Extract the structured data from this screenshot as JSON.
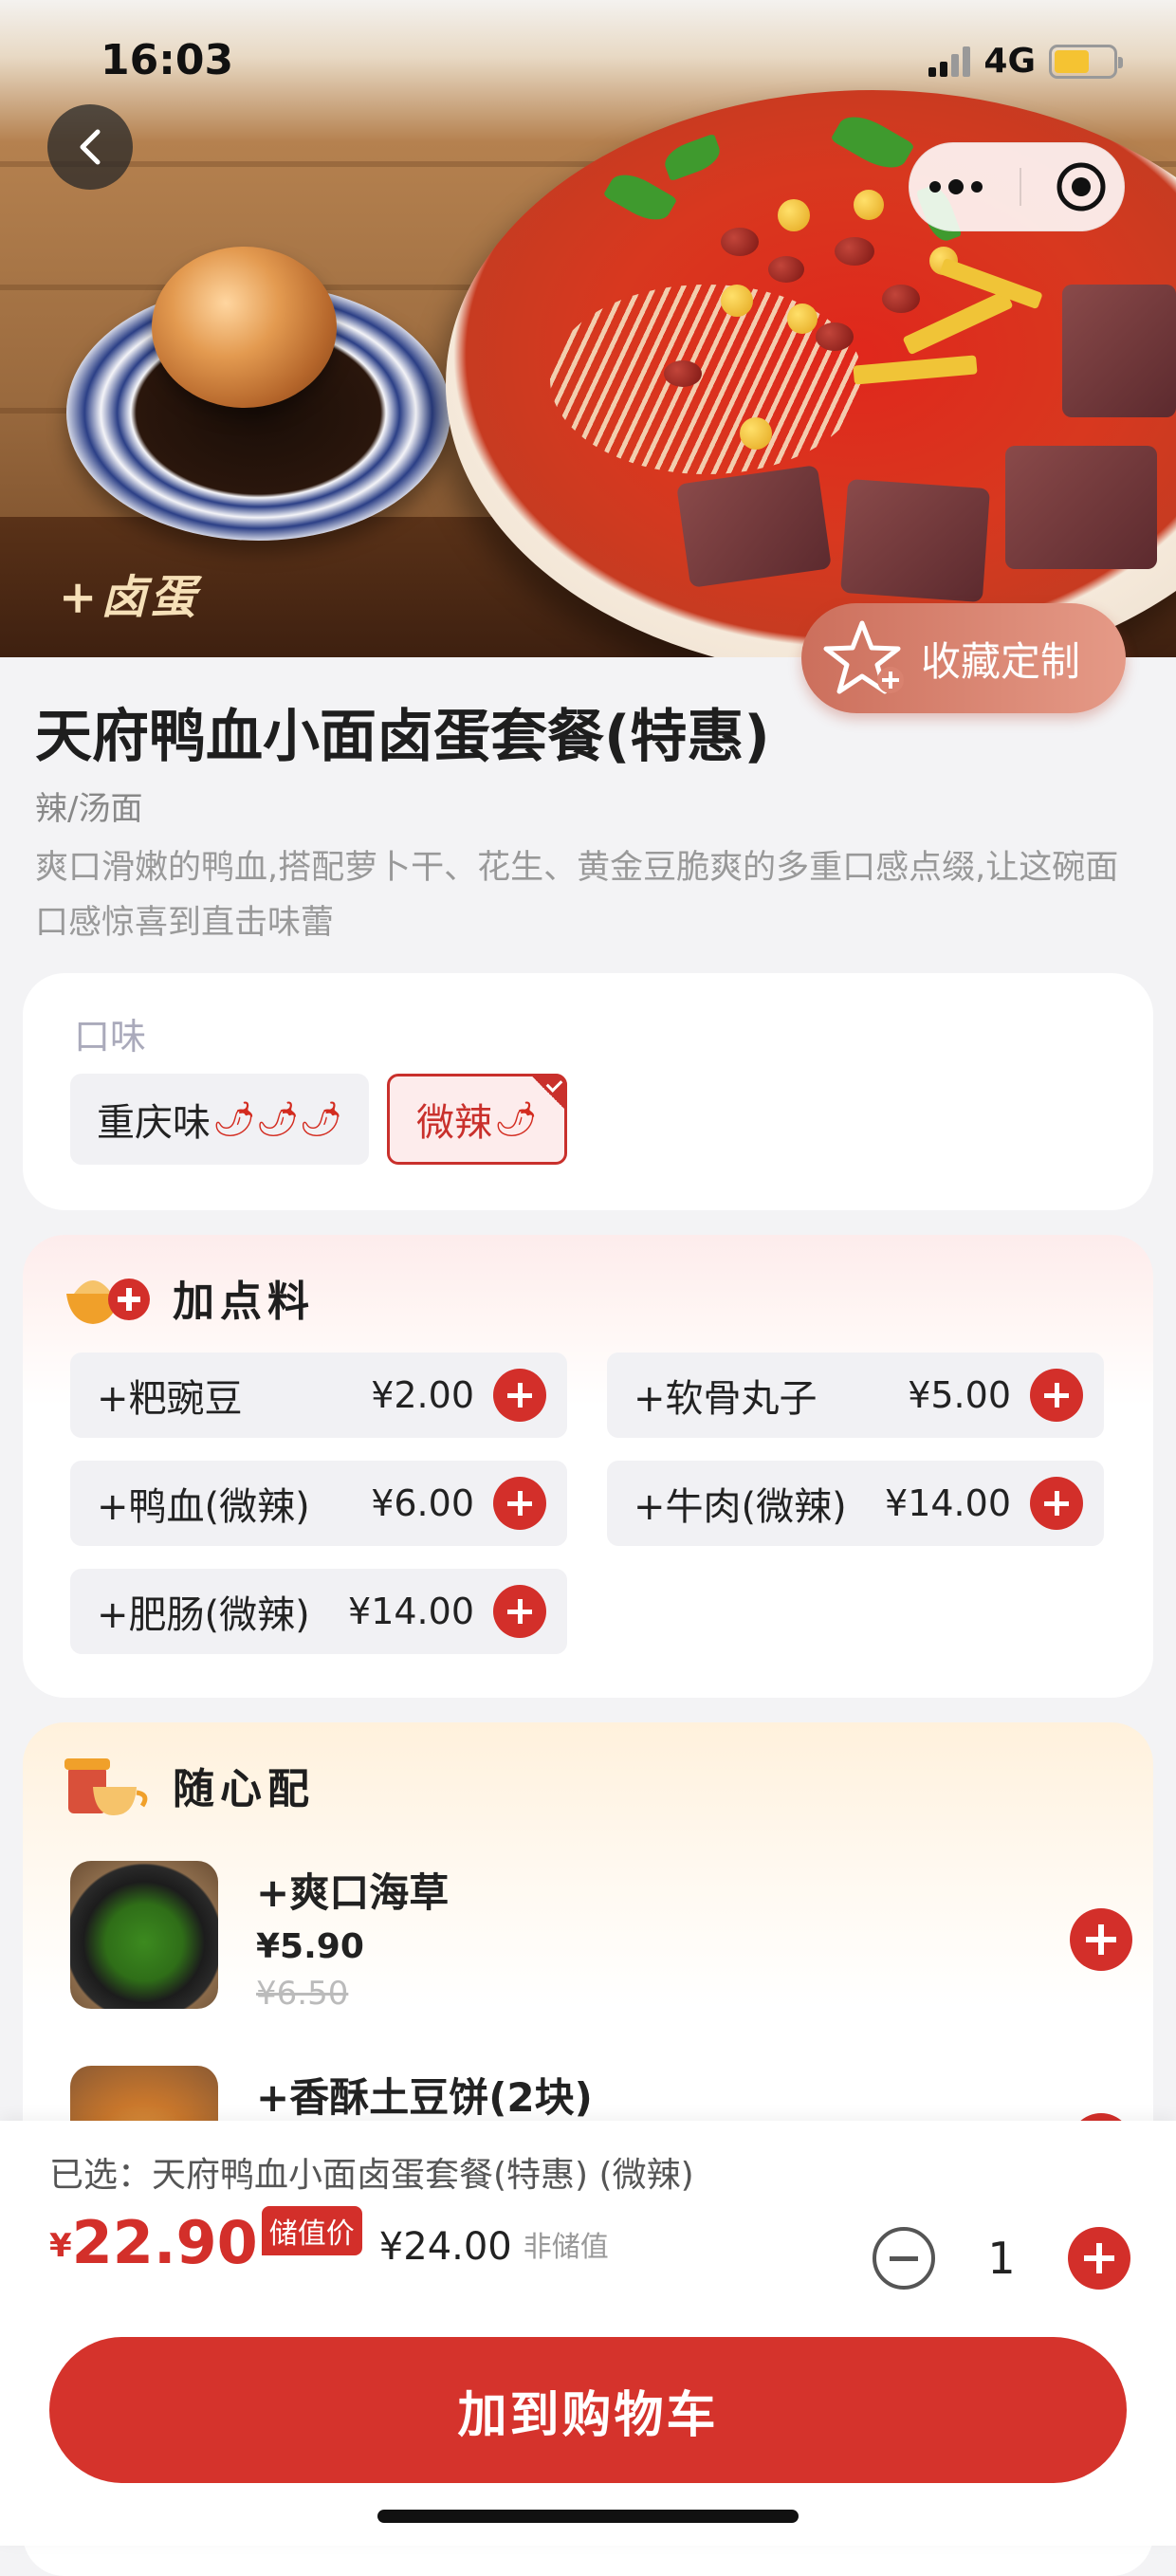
{
  "status_bar": {
    "time": "16:03",
    "network": "4G"
  },
  "hero": {
    "caption": "+卤蛋"
  },
  "favorite": {
    "label": "收藏定制"
  },
  "product": {
    "title": "天府鸭血小面卤蛋套餐(特惠)",
    "tags": "辣/汤面",
    "description": "爽口滑嫩的鸭血,搭配萝卜干、花生、黄金豆脆爽的多重口感点缀,让这碗面口感惊喜到直击味蕾"
  },
  "flavor": {
    "label": "口味",
    "options": [
      {
        "name": "重庆味",
        "peppers": "🌶🌶🌶",
        "selected": false
      },
      {
        "name": "微辣",
        "peppers": "🌶",
        "selected": true
      }
    ]
  },
  "addons": {
    "title": "加点料",
    "items": [
      {
        "name": "+粑豌豆",
        "price": "¥2.00"
      },
      {
        "name": "+软骨丸子",
        "price": "¥5.00"
      },
      {
        "name": "+鸭血(微辣)",
        "price": "¥6.00"
      },
      {
        "name": "+牛肉(微辣)",
        "price": "¥14.00"
      },
      {
        "name": "+肥肠(微辣)",
        "price": "¥14.00"
      }
    ]
  },
  "combos": {
    "title": "随心配",
    "items": [
      {
        "name": "+爽口海草",
        "price": "¥5.90",
        "old_price": "¥6.50"
      },
      {
        "name": "+香酥土豆饼(2块)",
        "price": "",
        "old_price": ""
      }
    ]
  },
  "summary": {
    "selected_label": "已选：天府鸭血小面卤蛋套餐(特惠) (微辣)",
    "currency": "¥",
    "price": "22.90",
    "price_badge": "储值价",
    "alt_price": "¥24.00",
    "alt_label": "非储值",
    "quantity": "1",
    "add_to_cart": "加到购物车"
  },
  "colors": {
    "accent": "#d32f2a",
    "favorite_button": "#d9826f",
    "background": "#f3f3f5"
  },
  "icons": [
    "back-icon",
    "more-icon",
    "target-icon",
    "star-plus-icon",
    "plus-icon",
    "minus-icon",
    "chili-icon"
  ]
}
